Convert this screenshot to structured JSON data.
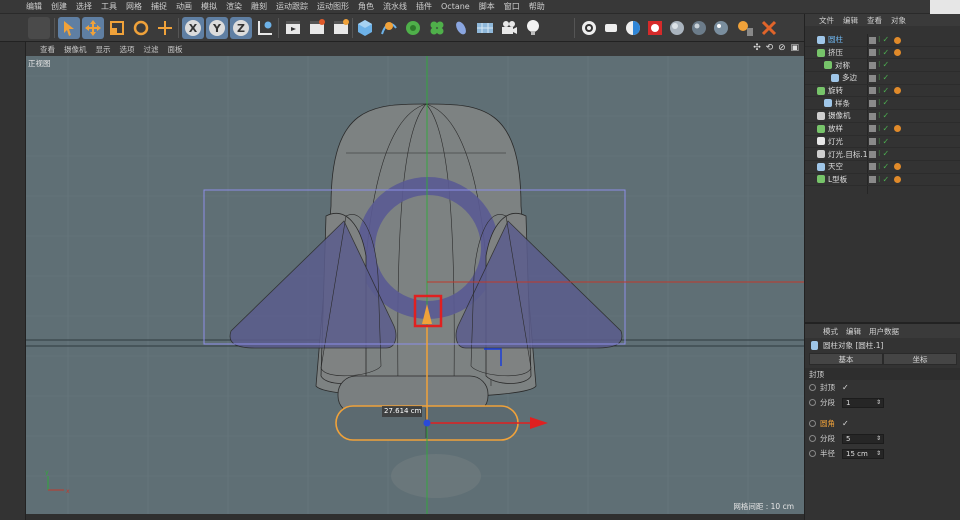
{
  "menu": [
    "编辑",
    "创建",
    "选择",
    "工具",
    "网格",
    "捕捉",
    "动画",
    "模拟",
    "渲染",
    "雕刻",
    "运动跟踪",
    "运动图形",
    "角色",
    "流水线",
    "插件",
    "Octane",
    "脚本",
    "窗口",
    "帮助"
  ],
  "viewport": {
    "menu": [
      "查看",
      "摄像机",
      "显示",
      "选项",
      "过滤",
      "面板"
    ],
    "view_label": "正视图",
    "grid_label": "网格间距 : 10 cm",
    "dimension_label": "27.614 cm"
  },
  "object_manager": {
    "tabs": [
      "文件",
      "编辑",
      "查看",
      "对象"
    ],
    "objects": [
      {
        "name": "圆柱",
        "color": "#9fc6e8",
        "indent": 0,
        "highlight": true,
        "tag": true
      },
      {
        "name": "挤压",
        "color": "#77c46a",
        "indent": 0,
        "highlight": false,
        "tag": true
      },
      {
        "name": "对称",
        "color": "#77c46a",
        "indent": 1,
        "highlight": false,
        "tag": false
      },
      {
        "name": "多边",
        "color": "#9fc6e8",
        "indent": 2,
        "highlight": false,
        "tag": false
      },
      {
        "name": "旋转",
        "color": "#77c46a",
        "indent": 0,
        "highlight": false,
        "tag": true
      },
      {
        "name": "样条",
        "color": "#9fc6e8",
        "indent": 1,
        "highlight": false,
        "tag": false
      },
      {
        "name": "摄像机",
        "color": "#cfcfcf",
        "indent": 0,
        "highlight": false,
        "tag": false
      },
      {
        "name": "放样",
        "color": "#77c46a",
        "indent": 0,
        "highlight": false,
        "tag": true
      },
      {
        "name": "灯光",
        "color": "#e8e8e8",
        "indent": 0,
        "highlight": false,
        "tag": false
      },
      {
        "name": "灯光.目标.1",
        "color": "#cfcfcf",
        "indent": 0,
        "highlight": false,
        "tag": false
      },
      {
        "name": "天空",
        "color": "#9fc6e8",
        "indent": 0,
        "highlight": false,
        "tag": true
      },
      {
        "name": "L型板",
        "color": "#77c46a",
        "indent": 0,
        "highlight": false,
        "tag": true
      }
    ]
  },
  "attribute_manager": {
    "tabs": [
      "模式",
      "编辑",
      "用户数据"
    ],
    "title": "圆柱对象 [圆柱.1]",
    "buttons": [
      "基本",
      "坐标"
    ],
    "section": "封顶",
    "rows": [
      {
        "label": "封顶",
        "check": "✓",
        "value": "",
        "active": false
      },
      {
        "label": "分段",
        "check": "",
        "value": "1",
        "active": false
      },
      {
        "label": "圆角",
        "check": "✓",
        "value": "",
        "active": true
      },
      {
        "label": "分段",
        "check": "",
        "value": "5",
        "active": false
      },
      {
        "label": "半径",
        "check": "",
        "value": "15 cm",
        "active": false
      }
    ]
  },
  "toolbar_icons": [
    "undo-icon",
    "select-icon",
    "move-icon",
    "scale-icon",
    "rotate-icon",
    "add-icon",
    "x-axis-icon",
    "y-axis-icon",
    "z-axis-icon",
    "coordinate-icon",
    "render-view-icon",
    "render-picture-icon",
    "render-settings-icon",
    "cube-icon",
    "pen-icon",
    "subdivision-icon",
    "cloner-icon",
    "deformer-icon",
    "floor-icon",
    "camera-icon",
    "light-icon"
  ],
  "colors": {
    "viewport_bg": "#5f6f75",
    "selection": "#f0a23a",
    "accent": "#5f7fa3"
  }
}
